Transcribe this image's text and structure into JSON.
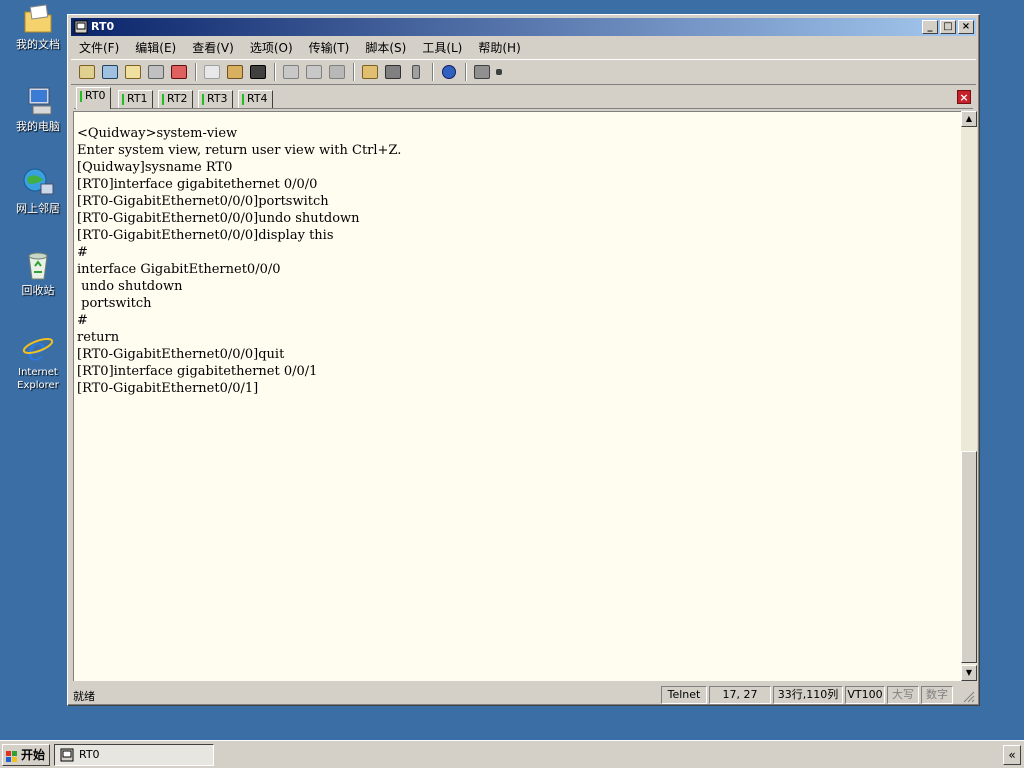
{
  "desktop": {
    "icons": [
      {
        "label": "我的文档",
        "icon": "my-documents-icon"
      },
      {
        "label": "我的电脑",
        "icon": "my-computer-icon"
      },
      {
        "label": "网上邻居",
        "icon": "network-places-icon"
      },
      {
        "label": "回收站",
        "icon": "recycle-bin-icon"
      },
      {
        "label": "Internet Explorer",
        "icon": "internet-explorer-icon"
      }
    ]
  },
  "window": {
    "title": "RT0",
    "controls": {
      "minimize": "_",
      "maximize": "□",
      "close": "×"
    }
  },
  "menu": [
    "文件(F)",
    "编辑(E)",
    "查看(V)",
    "选项(O)",
    "传输(T)",
    "脚本(S)",
    "工具(L)",
    "帮助(H)"
  ],
  "tabs": [
    "RT0",
    "RT1",
    "RT2",
    "RT3",
    "RT4"
  ],
  "active_tab": "RT0",
  "terminal": {
    "lines": [
      "<Quidway>system-view",
      "Enter system view, return user view with Ctrl+Z.",
      "[Quidway]sysname RT0",
      "[RT0]interface gigabitethernet 0/0/0",
      "[RT0-GigabitEthernet0/0/0]portswitch",
      "[RT0-GigabitEthernet0/0/0]undo shutdown",
      "[RT0-GigabitEthernet0/0/0]display this",
      "#",
      "interface GigabitEthernet0/0/0",
      " undo shutdown",
      " portswitch",
      "#",
      "return",
      "[RT0-GigabitEthernet0/0/0]quit",
      "[RT0]interface gigabitethernet 0/0/1",
      "[RT0-GigabitEthernet0/0/1]"
    ]
  },
  "status": {
    "ready": "就绪",
    "protocol": "Telnet",
    "cursor": "17,  27",
    "size": "33行,110列",
    "terminal_type": "VT100",
    "caps": "大写",
    "num": "数字"
  },
  "taskbar": {
    "start": "开始",
    "task": "RT0",
    "tray_arrow": "«"
  },
  "colors": {
    "desktop": "#3a6ea5",
    "title_active_start": "#0a246a",
    "title_active_end": "#a6caf0",
    "terminal_bg": "#fffcf0",
    "tab_marker": "#20c020",
    "close_tab": "#c8202a"
  }
}
